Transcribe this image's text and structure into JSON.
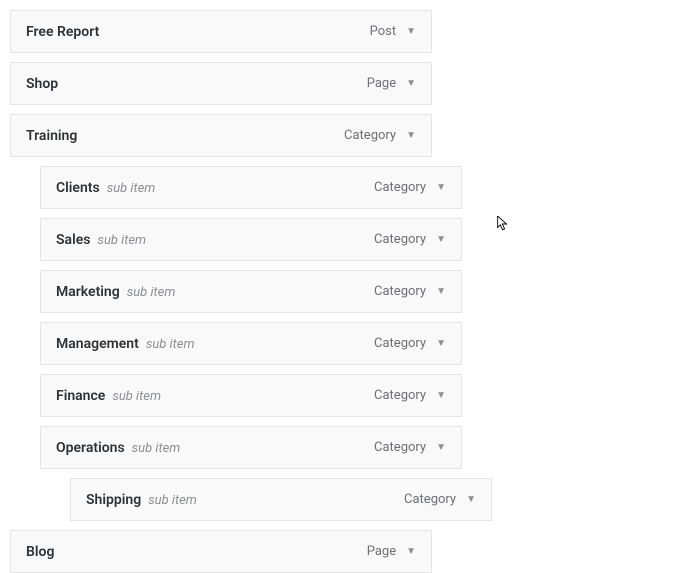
{
  "sub_item_label": "sub item",
  "menu": [
    {
      "title": "Free Report",
      "type": "Post",
      "depth": 0,
      "sub": false
    },
    {
      "title": "Shop",
      "type": "Page",
      "depth": 0,
      "sub": false
    },
    {
      "title": "Training",
      "type": "Category",
      "depth": 0,
      "sub": false
    },
    {
      "title": "Clients",
      "type": "Category",
      "depth": 1,
      "sub": true
    },
    {
      "title": "Sales",
      "type": "Category",
      "depth": 1,
      "sub": true
    },
    {
      "title": "Marketing",
      "type": "Category",
      "depth": 1,
      "sub": true
    },
    {
      "title": "Management",
      "type": "Category",
      "depth": 1,
      "sub": true
    },
    {
      "title": "Finance",
      "type": "Category",
      "depth": 1,
      "sub": true
    },
    {
      "title": "Operations",
      "type": "Category",
      "depth": 1,
      "sub": true
    },
    {
      "title": "Shipping",
      "type": "Category",
      "depth": 2,
      "sub": true
    },
    {
      "title": "Blog",
      "type": "Page",
      "depth": 0,
      "sub": false
    }
  ]
}
